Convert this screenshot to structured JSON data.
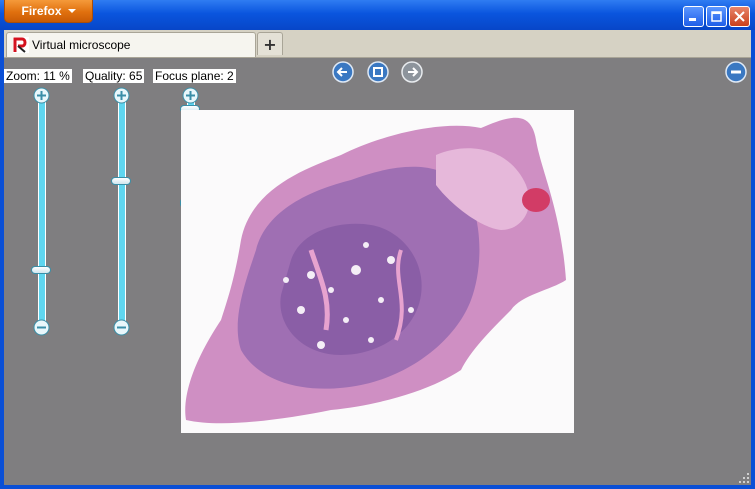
{
  "browser": {
    "app_button": "Firefox",
    "tab_title": "Virtual microscope",
    "new_tab_label": "+"
  },
  "viewer": {
    "zoom_label": "Zoom: 11 %",
    "quality_label": "Quality: 65",
    "focus_label": "Focus plane: 2",
    "zoom_level": 0.22,
    "quality_level": 0.65,
    "focus_level": 1.0
  },
  "colors": {
    "background": "#7f7e80",
    "slider_track": "#5fd6f0",
    "tissue": "#c77dbd"
  },
  "icons": {
    "prev": "arrow-left-icon",
    "home": "home-square-icon",
    "next": "arrow-right-icon",
    "menu": "minus-circle-icon"
  }
}
